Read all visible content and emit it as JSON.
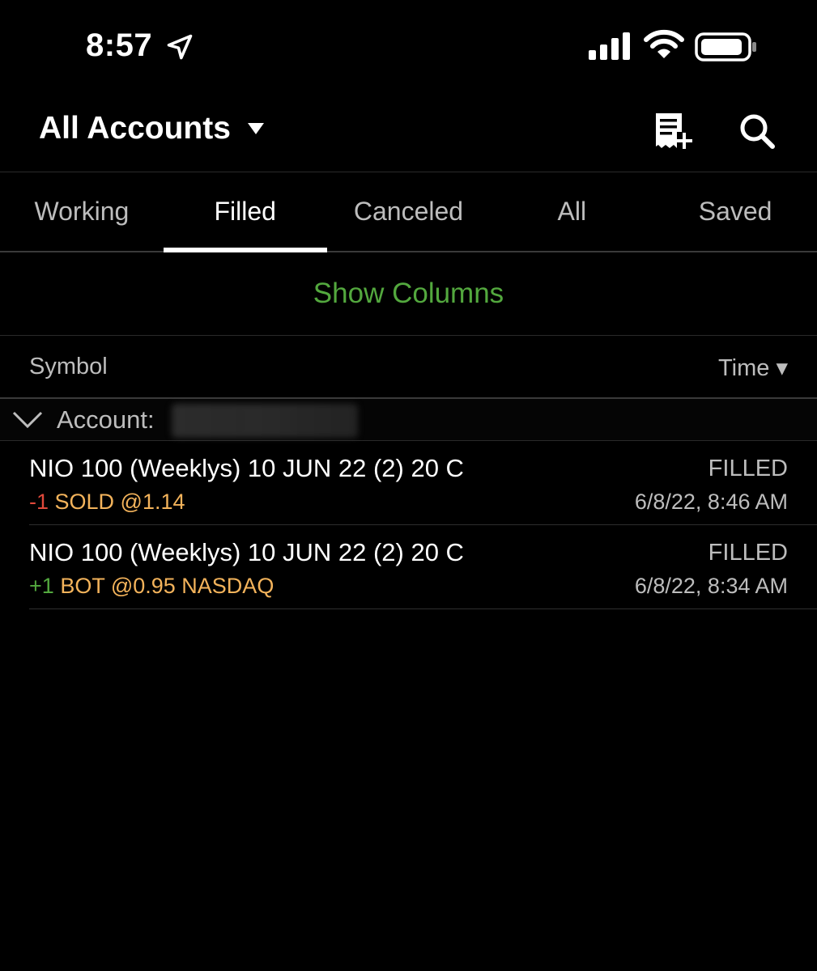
{
  "status_bar": {
    "time": "8:57"
  },
  "header": {
    "account_title": "All Accounts",
    "icons": [
      "location-icon",
      "signal-icon",
      "wifi-icon",
      "battery-icon",
      "caret-down-icon",
      "new-order-icon",
      "search-icon"
    ]
  },
  "tabs": [
    {
      "label": "Working",
      "active": false
    },
    {
      "label": "Filled",
      "active": true
    },
    {
      "label": "Canceled",
      "active": false
    },
    {
      "label": "All",
      "active": false
    },
    {
      "label": "Saved",
      "active": false
    }
  ],
  "show_columns_label": "Show Columns",
  "columns": {
    "symbol": "Symbol",
    "time": "Time ▾"
  },
  "account_group": {
    "label": "Account:"
  },
  "orders": [
    {
      "symbol": "NIO 100 (Weeklys) 10 JUN 22 (2) 20 C",
      "qty": "-1",
      "action": "SOLD @1.14",
      "status": "FILLED",
      "time": "6/8/22, 8:46 AM"
    },
    {
      "symbol": "NIO 100 (Weeklys) 10 JUN 22 (2) 20 C",
      "qty": "+1",
      "action": "BOT @0.95 NASDAQ",
      "status": "FILLED",
      "time": "6/8/22, 8:34 AM"
    }
  ],
  "colors": {
    "accent_green": "#53a83e",
    "sell_red": "#e0493b",
    "action_orange": "#f3b35b",
    "muted_text": "#bdbdbd"
  }
}
